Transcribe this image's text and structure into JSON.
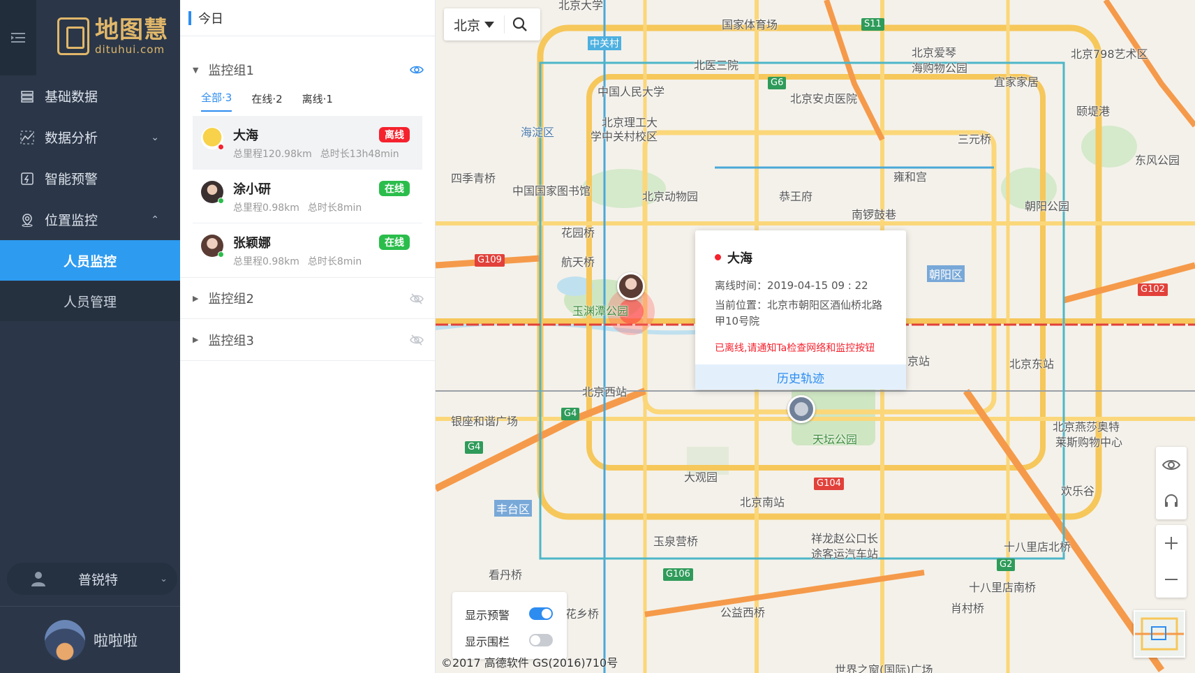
{
  "app": {
    "logo_title": "地图慧",
    "logo_url": "dituhui.com",
    "menu_toggle_icon": "menu-collapse-icon"
  },
  "sidebar": {
    "items": [
      {
        "label": "基础数据",
        "icon": "database-icon"
      },
      {
        "label": "数据分析",
        "icon": "analytics-icon",
        "chevron": "⌄"
      },
      {
        "label": "智能预警",
        "icon": "alert-icon"
      },
      {
        "label": "位置监控",
        "icon": "location-icon",
        "chevron": "⌃"
      }
    ],
    "subitems": [
      {
        "label": "人员监控",
        "active": true
      },
      {
        "label": "人员管理",
        "active": false
      }
    ],
    "org": {
      "name": "普锐特",
      "chevron": "⌄"
    },
    "user": {
      "name": "啦啦啦"
    }
  },
  "panel": {
    "date_label": "今日",
    "groups": [
      {
        "name": "监控组1",
        "expanded": true,
        "visible": true
      },
      {
        "name": "监控组2",
        "expanded": false,
        "visible": false
      },
      {
        "name": "监控组3",
        "expanded": false,
        "visible": false
      }
    ],
    "tabs": [
      "全部·3",
      "在线·2",
      "离线·1"
    ],
    "people": [
      {
        "name": "大海",
        "status": "离线",
        "distance": "总里程120.98km",
        "duration": "总时长13h48min",
        "status_color": "#f5222d"
      },
      {
        "name": "涂小研",
        "status": "在线",
        "distance": "总里程0.98km",
        "duration": "总时长8min",
        "status_color": "#2bbd4b"
      },
      {
        "name": "张颖娜",
        "status": "在线",
        "distance": "总里程0.98km",
        "duration": "总时长8min",
        "status_color": "#2bbd4b"
      }
    ]
  },
  "map": {
    "city": "北京",
    "popup": {
      "name": "大海",
      "offline_time": "离线时间：2019-04-15 09 : 22",
      "location_line1": "当前位置：北京市朝阳区酒仙桥北路",
      "location_line2": "甲10号院",
      "warning": "已离线,请通知Ta检查网络和监控按钮",
      "history_button": "历史轨迹"
    },
    "toggles": [
      {
        "label": "显示预警",
        "on": true
      },
      {
        "label": "显示围栏",
        "on": false
      }
    ],
    "copyright": "©2017 高德软件 GS(2016)710号",
    "labels": [
      "国家体育场",
      "北医三院",
      "中国人民大学",
      "北京理工大",
      "学中关村校区",
      "海淀区",
      "北京安贞医院",
      "北京爱琴",
      "海购物公园",
      "宜家家居",
      "北京798艺术区",
      "颐堤港",
      "三元桥",
      "东风公园",
      "四季青桥",
      "中国国家图书馆",
      "北京动物园",
      "恭王府",
      "雍和宫",
      "南锣鼓巷",
      "朝阳公园",
      "花园桥",
      "航天桥",
      "玉渊潭公园",
      "朝阳区",
      "北京西站",
      "北京东站",
      "银座和谐广场",
      "天坛公园",
      "大观园",
      "北京南站",
      "丰台区",
      "北京燕莎奥特",
      "莱斯购物中心",
      "欢乐谷",
      "玉泉营桥",
      "祥龙赵公口长",
      "途客运汽车站",
      "十八里店北桥",
      "看丹桥",
      "十八里店南桥",
      "花乡桥",
      "公益西桥",
      "肖村桥",
      "京站",
      "中关村",
      "北京大学",
      "世界之窗(国际)广场"
    ],
    "shields": [
      "G109",
      "G4",
      "G4",
      "G104",
      "G106",
      "G102",
      "G6",
      "G2",
      "S11"
    ]
  }
}
